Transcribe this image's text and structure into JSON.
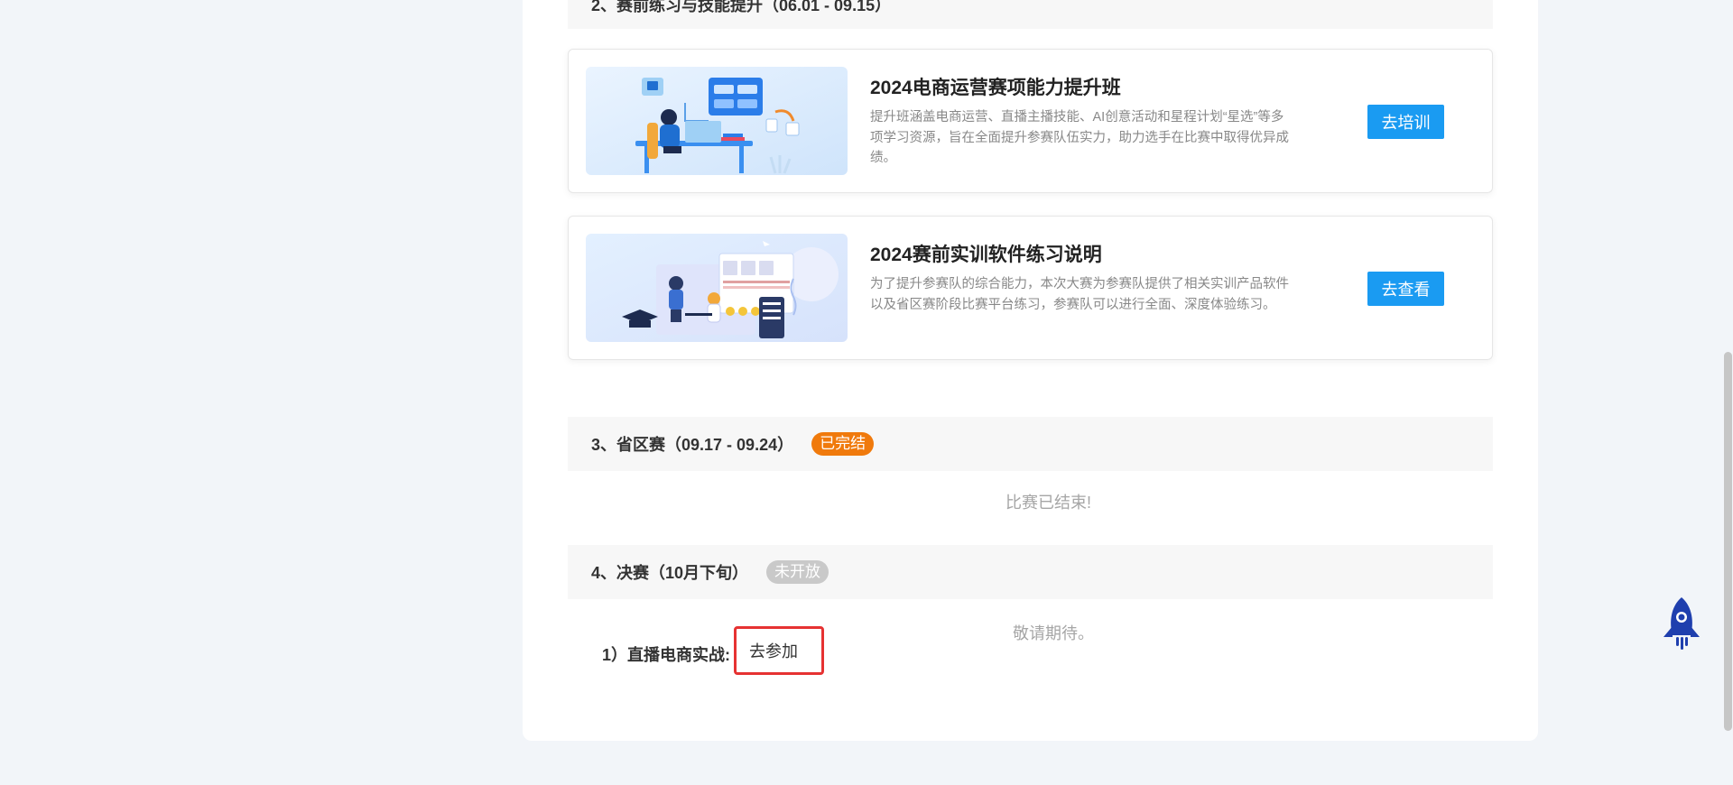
{
  "section2": {
    "title": "2、赛前练习与技能提升（06.01 - 09.15）"
  },
  "cards": [
    {
      "title": "2024电商运营赛项能力提升班",
      "desc": "提升班涵盖电商运营、直播主播技能、AI创意活动和星程计划“星选”等多项学习资源，旨在全面提升参赛队伍实力，助力选手在比赛中取得优异成绩。",
      "button": "去培训"
    },
    {
      "title": "2024赛前实训软件练习说明",
      "desc": "为了提升参赛队的综合能力，本次大赛为参赛队提供了相关实训产品软件以及省区赛阶段比赛平台练习，参赛队可以进行全面、深度体验练习。",
      "button": "去查看"
    }
  ],
  "section3": {
    "title": "3、省区赛（09.17 - 09.24）",
    "badge": "已完结",
    "status": "比赛已结束!"
  },
  "section4": {
    "title": "4、决赛（10月下旬）",
    "badge": "未开放",
    "status": "敬请期待。",
    "item_label": "1）直播电商实战:",
    "join_button": "去参加"
  },
  "colors": {
    "accent": "#1a9bf2",
    "badge_done": "#f07a0c",
    "badge_closed": "#c9c9c9",
    "highlight": "#e63232"
  }
}
